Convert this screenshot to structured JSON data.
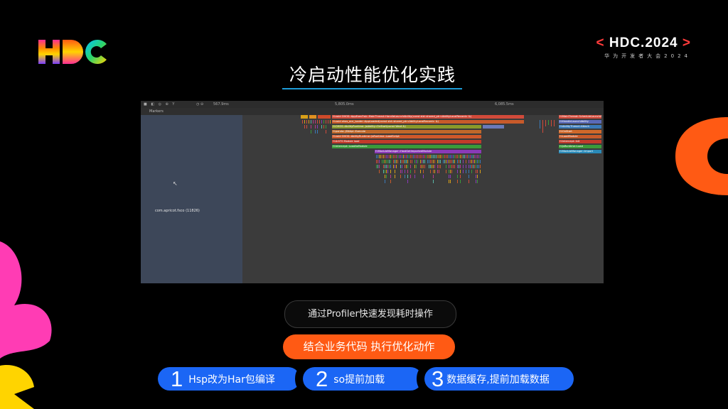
{
  "brand": {
    "open_bracket": "<",
    "name": "HDC.2024",
    "close_bracket": ">",
    "subtitle": "华为开发者大会2024"
  },
  "slide": {
    "title": "冷启动性能优化实践"
  },
  "profiler": {
    "zoom_value": "567.9ms",
    "markers_label": "Markers",
    "ruler_left": "5,805.0ms",
    "ruler_right": "6,085.5ms",
    "thread_label": "com.apricot.fsco (11826)",
    "frame_labels": [
      "H:void OHOS::AppExecFwk::MainThread::HandleLaunchAbility(const std::shared_ptr<AbilityLocalRecord> &)",
      "H:void ohos_ace_loader::AppLoaded(const std::shared_ptr<AbilityLocalRecord> &)",
      "H:OHOS::AbilityRuntime::JsAbility::OnStart(const Want &)",
      "H:panda::JSNApi::Execute",
      "H:void OHOS::AbilityRuntime::JsRuntime::LoadScript",
      "H:ArkTS Module load",
      "H:Intercept::LoadAsModule",
      "H:ModuleManager::HostGetImportedModule"
    ],
    "right_labels": [
      "H:MainThread::ScheduleLaunchAbility",
      "H:HandleLaunchAbility",
      "H:AbilityThread::Attach",
      "H:OnStart",
      "H:LoadModule",
      "H:Intercept::Init",
      "H:JsRuntime::Load",
      "H:ModuleManager::Import"
    ]
  },
  "pills": {
    "profiler_tip": "通过Profiler快速发现耗时操作",
    "combine_tip": "结合业务代码 执行优化动作"
  },
  "steps": [
    {
      "num": "1",
      "text": "Hsp改为Har包编译"
    },
    {
      "num": "2",
      "text": "so提前加载"
    },
    {
      "num": "3",
      "text": "数据缓存,提前加载数据"
    }
  ],
  "colors": {
    "accent_blue": "#1b66f5",
    "accent_orange": "#ff5a14",
    "title_underline": "#1e9cd8"
  }
}
